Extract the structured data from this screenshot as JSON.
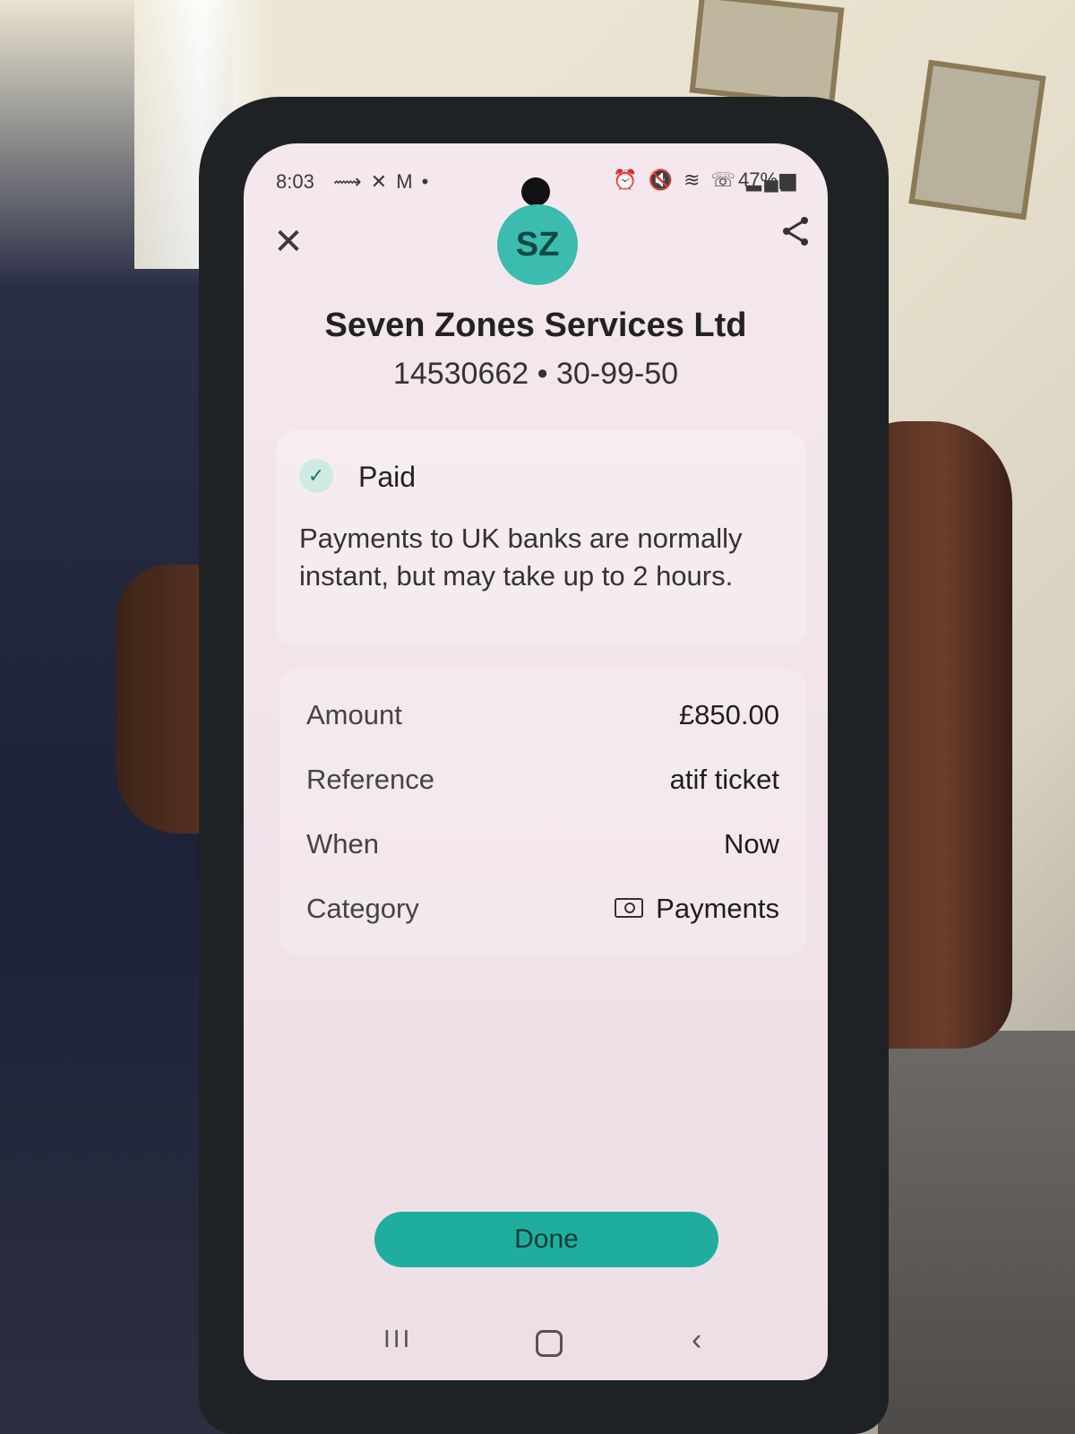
{
  "status_bar": {
    "time": "8:03",
    "left_icons": "⟿ ✕ M •",
    "right_icons": "⏰ 🔇 ≋ ☏ ▂▄▆",
    "battery": "47%▮"
  },
  "header": {
    "avatar_initials": "SZ",
    "payee_name": "Seven Zones Services Ltd",
    "payee_account": "14530662 • 30-99-50"
  },
  "status": {
    "title": "Paid",
    "description": "Payments to UK banks are normally instant, but may take up to 2 hours."
  },
  "details": [
    {
      "label": "Amount",
      "value": "£850.00"
    },
    {
      "label": "Reference",
      "value": "atif ticket"
    },
    {
      "label": "When",
      "value": "Now"
    },
    {
      "label": "Category",
      "value": "Payments"
    }
  ],
  "actions": {
    "done_label": "Done"
  },
  "nav": {
    "recent": "III",
    "back": "‹"
  },
  "colors": {
    "accent": "#1fae9e",
    "avatar_bg": "#3bbcae",
    "screen_bg": "#f2e4eb"
  }
}
